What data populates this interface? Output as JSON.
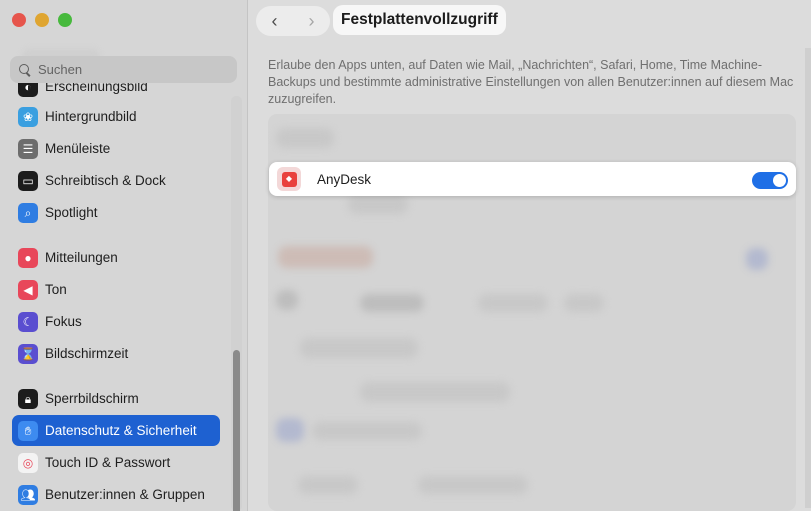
{
  "window": {
    "traffic_lights": {
      "close_color": "#e6554c",
      "minimize_color": "#dfa531",
      "zoom_color": "#47b93d"
    }
  },
  "sidebar": {
    "search_placeholder": "Suchen",
    "items": [
      {
        "label": "Erscheinungsbild",
        "icon": "appearance-icon",
        "color": "#1c1c1c"
      },
      {
        "label": "Hintergrundbild",
        "icon": "wallpaper-icon",
        "color": "#3a9fe0"
      },
      {
        "label": "Menüleiste",
        "icon": "menubar-icon",
        "color": "#6d6d6d"
      },
      {
        "label": "Schreibtisch & Dock",
        "icon": "dock-icon",
        "color": "#1c1c1c"
      },
      {
        "label": "Spotlight",
        "icon": "spotlight-icon",
        "color": "#2f7de2"
      },
      {
        "label": "Mitteilungen",
        "icon": "notifications-icon",
        "color": "#e8475a"
      },
      {
        "label": "Ton",
        "icon": "sound-icon",
        "color": "#e8475a"
      },
      {
        "label": "Fokus",
        "icon": "focus-icon",
        "color": "#5a4ed0"
      },
      {
        "label": "Bildschirmzeit",
        "icon": "screentime-icon",
        "color": "#5a4ed0"
      },
      {
        "label": "Sperrbildschirm",
        "icon": "lock-icon",
        "color": "#1c1c1c"
      },
      {
        "label": "Datenschutz & Sicherheit",
        "icon": "privacy-hand-icon",
        "color": "#3d8bf0",
        "selected": true
      },
      {
        "label": "Touch ID & Passwort",
        "icon": "fingerprint-icon",
        "color": "#f3f3f3"
      },
      {
        "label": "Benutzer:innen & Gruppen",
        "icon": "users-icon",
        "color": "#2f7de2"
      }
    ]
  },
  "toolbar": {
    "back_icon": "chevron-left-icon",
    "forward_icon": "chevron-right-icon",
    "title": "Festplattenvollzugriff"
  },
  "content": {
    "description": "Erlaube den Apps unten, auf Daten wie Mail, „Nachrichten“, Safari, Home, Time Machine-Backups und bestimmte administrative Einstellungen von allen Benutzer:innen auf diesem Mac zuzugreifen.",
    "highlighted_app": {
      "name": "AnyDesk",
      "icon": "anydesk-icon",
      "enabled": true,
      "toggle_color": "#1f6fe6"
    }
  }
}
